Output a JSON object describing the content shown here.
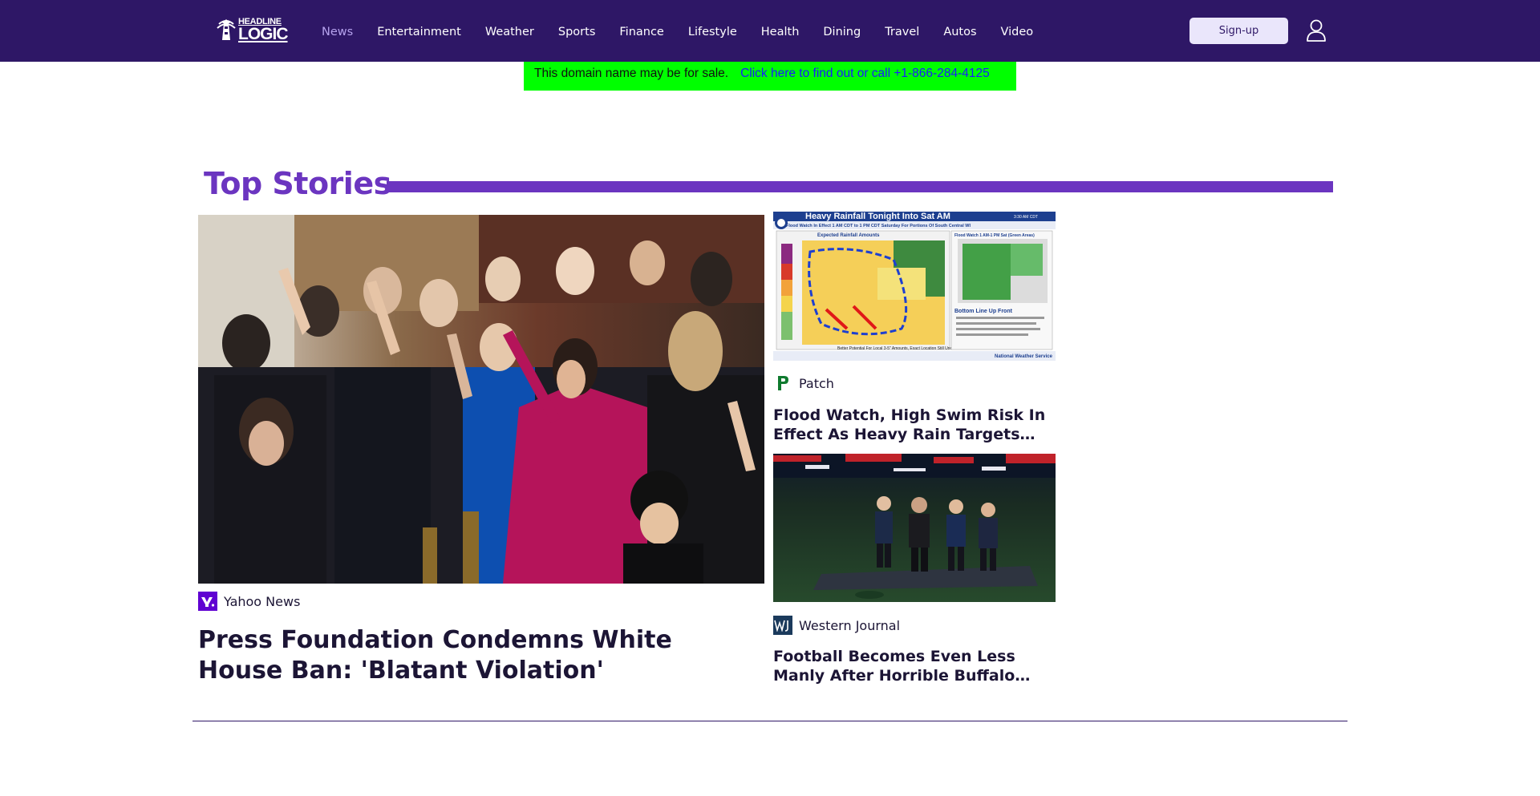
{
  "header": {
    "logo": {
      "line1": "HEADLINE",
      "line2": "LOGIC"
    },
    "nav": [
      {
        "label": "News",
        "active": true
      },
      {
        "label": "Entertainment",
        "active": false
      },
      {
        "label": "Weather",
        "active": false
      },
      {
        "label": "Sports",
        "active": false
      },
      {
        "label": "Finance",
        "active": false
      },
      {
        "label": "Lifestyle",
        "active": false
      },
      {
        "label": "Health",
        "active": false
      },
      {
        "label": "Dining",
        "active": false
      },
      {
        "label": "Travel",
        "active": false
      },
      {
        "label": "Autos",
        "active": false
      },
      {
        "label": "Video",
        "active": false
      }
    ],
    "signup_label": "Sign-up",
    "account_icon": "user-icon"
  },
  "banner": {
    "message": "This domain name may be for sale.",
    "link_text": "Click here to find out or call +1-866-284-4125"
  },
  "top_stories": {
    "title": "Top Stories",
    "lead": {
      "source": "Yahoo News",
      "source_icon": "yahoo-logo-icon",
      "headline": "Press Foundation Condemns White House Ban: 'Blatant Violation'"
    },
    "side": [
      {
        "source": "Patch",
        "source_icon": "patch-logo-icon",
        "headline": "Flood Watch, High Swim Risk In Effect As Heavy Rain Targets Southern Wisconsin",
        "image_text": {
          "title": "Heavy Rainfall Tonight Into Sat AM",
          "time": "3:30 AM CDT",
          "subtitle": "Flood Watch In Effect 1 AM CDT to 1 PM CDT Saturday For Portions Of South Central WI",
          "left_panel": "Expected Rainfall Amounts",
          "right_panel": "Flood Watch 1 AM-1 PM Sat (Green Areas)",
          "bottom_line": "Bottom Line Up Front",
          "note": "Better Potential For Local 3-5\" Amounts, Exact Location Still Uncertain",
          "agency": "National Weather Service"
        }
      },
      {
        "source": "Western Journal",
        "source_icon": "western-journal-logo-icon",
        "headline": "Football Becomes Even Less Manly After Horrible Buffalo Bills Halftime Show"
      }
    ]
  },
  "colors": {
    "header_bg": "#2e1766",
    "accent": "#6b35c0",
    "active_nav": "#b6a3ee",
    "banner_bg": "#00ff00",
    "banner_link": "#1a1aff"
  }
}
